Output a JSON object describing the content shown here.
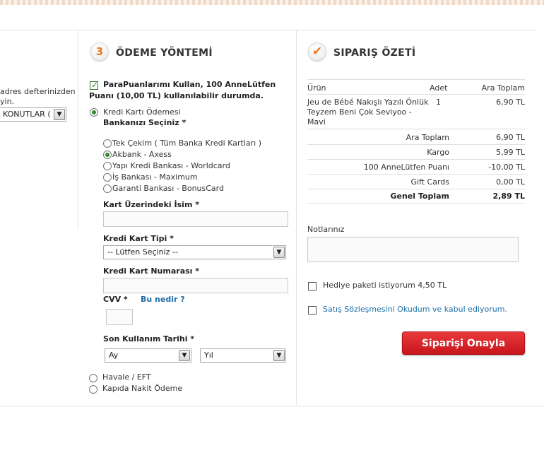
{
  "left": {
    "address_text_1": "adres defterinizden",
    "address_text_2": "yin.",
    "address_select": "KONUTLAR ("
  },
  "payment": {
    "step_number": "3",
    "title": "ÖDEME YÖNTEMİ",
    "parapuan_line1": "ParaPuanlarımı Kullan, 100 AnneLütfen",
    "parapuan_line2": "Puanı (10,00 TL) kullanılabilir durumda.",
    "credit_card_label": "Kredi Kartı Ödemesi",
    "bank_select_label": "Bankanızı Seçiniz *",
    "banks": [
      {
        "label": "Tek Çekim ( Tüm Banka Kredi Kartları )",
        "selected": false
      },
      {
        "label": "Akbank - Axess",
        "selected": true
      },
      {
        "label": "Yapı Kredi Bankası - Worldcard",
        "selected": false
      },
      {
        "label": "İş Bankası - Maximum",
        "selected": false
      },
      {
        "label": "Garanti Bankası - BonusCard",
        "selected": false
      }
    ],
    "card_name_label": "Kart Üzerindeki İsim *",
    "card_type_label": "Kredi Kart Tipi *",
    "card_type_value": "-- Lütfen Seçiniz --",
    "card_number_label": "Kredi Kart Numarası *",
    "cvv_label": "CVV *",
    "cvv_help": "Bu nedir ?",
    "expiry_label": "Son Kullanım Tarihi *",
    "month_value": "Ay",
    "year_value": "Yıl",
    "transfer_label": "Havale / EFT",
    "cash_label": "Kapıda Nakit Ödeme"
  },
  "summary": {
    "title": "SIPARIŞ ÖZETİ",
    "headers": {
      "product": "Ürün",
      "qty": "Adet",
      "subtotal": "Ara Toplam"
    },
    "item": {
      "name_line1": "Jeu de Bébé Nakışlı Yazılı Önlük",
      "name_line2": "Teyzem Beni Çok Seviyoo -",
      "name_line3": "Mavi",
      "qty": "1",
      "price": "6,90 TL"
    },
    "totals": [
      {
        "label": "Ara Toplam",
        "value": "6,90 TL"
      },
      {
        "label": "Kargo",
        "value": "5,99 TL"
      },
      {
        "label": "100 AnneLütfen Puanı",
        "value": "-10,00 TL"
      },
      {
        "label": "Gift Cards",
        "value": "0,00 TL"
      }
    ],
    "grand_total_label": "Genel Toplam",
    "grand_total_value": "2,89 TL",
    "notes_label": "Notlarınız",
    "gift_label": "Hediye paketi istiyorum 4,50 TL",
    "contract_label": "Satış Sözleşmesini Okudum ve kabul ediyorum.",
    "confirm_button": "Siparişi Onayla"
  },
  "colors": {
    "accent_red": "#c8161c",
    "link_blue": "#1e6fa8",
    "step_orange": "#e87722"
  }
}
